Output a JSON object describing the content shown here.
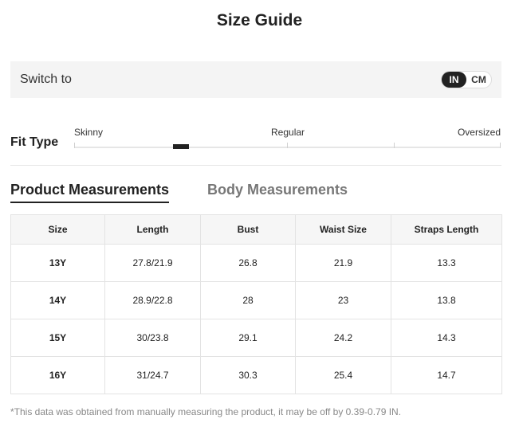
{
  "title": "Size Guide",
  "switch": {
    "label": "Switch to",
    "options": [
      "IN",
      "CM"
    ],
    "selected": "IN"
  },
  "fit": {
    "label": "Fit Type",
    "options": [
      "Skinny",
      "Regular",
      "Oversized"
    ]
  },
  "tabs": {
    "product": "Product Measurements",
    "body": "Body Measurements",
    "active": "product"
  },
  "table": {
    "headers": [
      "Size",
      "Length",
      "Bust",
      "Waist Size",
      "Straps Length"
    ],
    "rows": [
      [
        "13Y",
        "27.8/21.9",
        "26.8",
        "21.9",
        "13.3"
      ],
      [
        "14Y",
        "28.9/22.8",
        "28",
        "23",
        "13.8"
      ],
      [
        "15Y",
        "30/23.8",
        "29.1",
        "24.2",
        "14.3"
      ],
      [
        "16Y",
        "31/24.7",
        "30.3",
        "25.4",
        "14.7"
      ]
    ]
  },
  "footnote": "*This data was obtained from manually measuring the product, it may be off by 0.39-0.79 IN.",
  "colors": {
    "accent": "#222222",
    "switch_bg": "#f4f4f4",
    "inactive_tab": "#777777"
  }
}
